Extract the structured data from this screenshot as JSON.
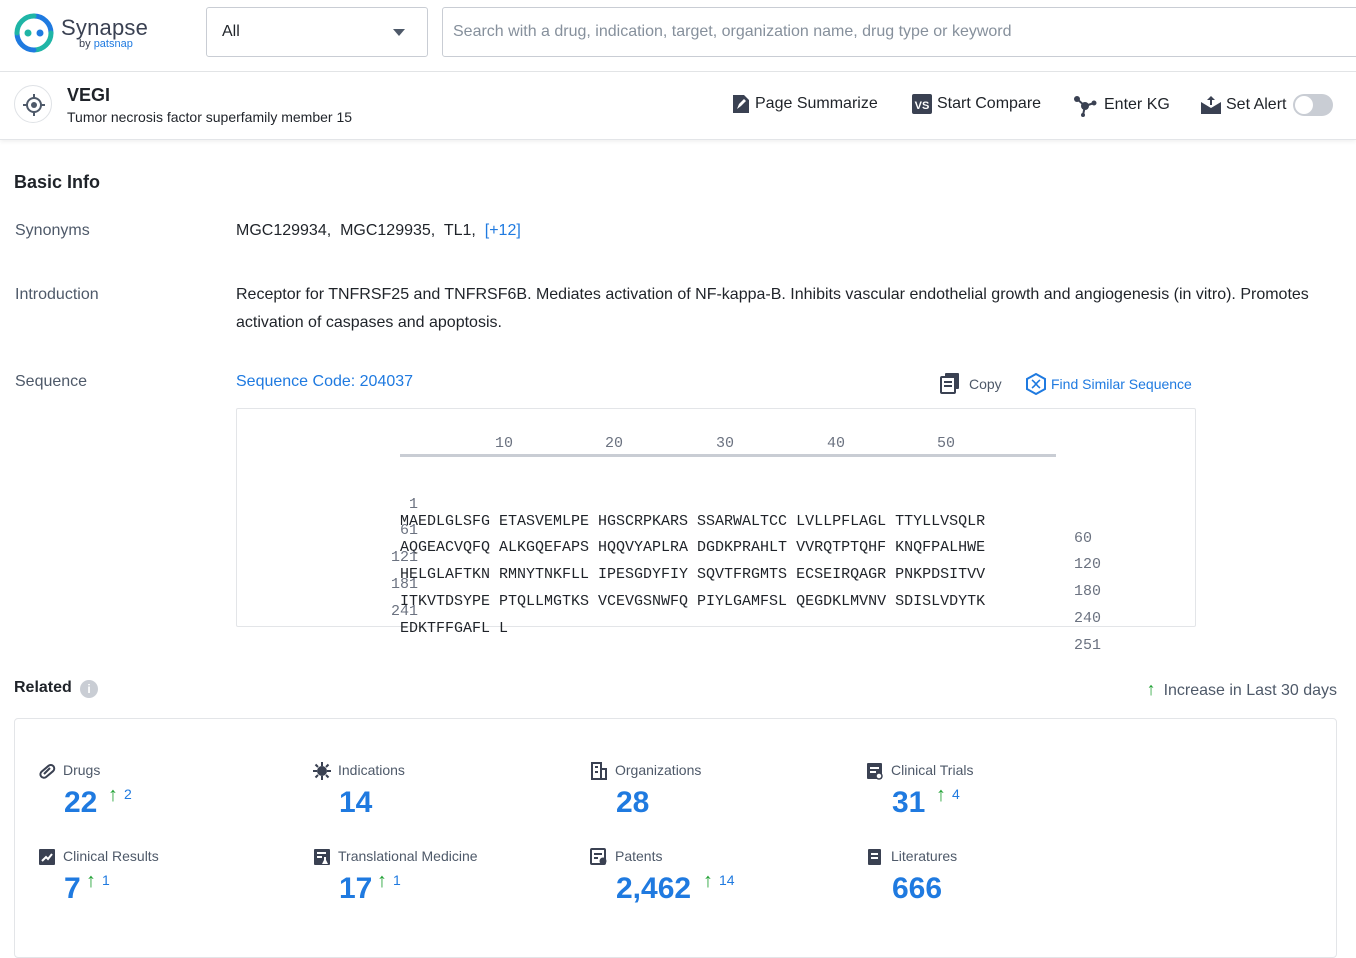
{
  "header": {
    "brand": "Synapse",
    "brand_by": "by",
    "brand_company": "patsnap",
    "scope_select": {
      "value": "All"
    },
    "search": {
      "placeholder": "Search with a drug, indication, target, organization name, drug type or keyword",
      "value": ""
    }
  },
  "entity": {
    "name": "VEGI",
    "full_name": "Tumor necrosis factor superfamily member 15",
    "actions": {
      "page_summarize": "Page Summarize",
      "start_compare": "Start Compare",
      "enter_kg": "Enter KG",
      "set_alert": "Set Alert"
    },
    "alert_enabled": false
  },
  "basic_info": {
    "title": "Basic Info",
    "synonyms_label": "Synonyms",
    "synonyms": [
      "MGC129934,",
      "MGC129935,",
      "TL1,"
    ],
    "synonyms_more": "[+12]",
    "introduction_label": "Introduction",
    "introduction": "Receptor for TNFRSF25 and TNFRSF6B. Mediates activation of NF-kappa-B. Inhibits vascular endothelial growth and angiogenesis (in vitro). Promotes activation of caspases and apoptosis.",
    "sequence_label": "Sequence",
    "sequence_code": "Sequence Code: 204037",
    "copy_label": "Copy",
    "find_similar_label": "Find Similar Sequence",
    "ruler_ticks": [
      "10",
      "20",
      "30",
      "40",
      "50"
    ],
    "sequence_rows": [
      {
        "start": "1",
        "seq": "MAEDLGLSFG ETASVEMLPE HGSCRPKARS SSARWALTCC LVLLPFLAGL TTYLLVSQLR",
        "end": "60"
      },
      {
        "start": "61",
        "seq": "AQGEACVQFQ ALKGQEFAPS HQQVYAPLRA DGDKPRAHLT VVRQTPTQHF KNQFPALHWE",
        "end": "120"
      },
      {
        "start": "121",
        "seq": "HELGLAFTKN RMNYTNKFLL IPESGDYFIY SQVTFRGMTS ECSEIRQAGR PNKPDSITVV",
        "end": "180"
      },
      {
        "start": "181",
        "seq": "ITKVTDSYPE PTQLLMGTKS VCEVGSNWFQ PIYLGAMFSL QEGDKLMVNV SDISLVDYTK",
        "end": "240"
      },
      {
        "start": "241",
        "seq": "EDKTFFGAFL L",
        "end": "251"
      }
    ]
  },
  "related": {
    "title": "Related",
    "increase_legend": "Increase in Last 30 days",
    "stats": [
      {
        "label": "Drugs",
        "value": "22",
        "increase": "2",
        "icon": "pill-icon"
      },
      {
        "label": "Indications",
        "value": "14",
        "increase": "",
        "icon": "virus-icon"
      },
      {
        "label": "Organizations",
        "value": "28",
        "increase": "",
        "icon": "building-icon"
      },
      {
        "label": "Clinical Trials",
        "value": "31",
        "increase": "4",
        "icon": "clipboard-icon"
      },
      {
        "label": "Clinical Results",
        "value": "7",
        "increase": "1",
        "icon": "chart-doc-icon"
      },
      {
        "label": "Translational Medicine",
        "value": "17",
        "increase": "1",
        "icon": "doc-flask-icon"
      },
      {
        "label": "Patents",
        "value": "2,462",
        "increase": "14",
        "icon": "patent-icon"
      },
      {
        "label": "Literatures",
        "value": "666",
        "increase": "",
        "icon": "book-icon"
      }
    ]
  },
  "colors": {
    "accent": "#1f7ae0",
    "increase_arrow": "#23a236",
    "logo_teal": "#1fb5a6",
    "logo_blue": "#1f7ae0"
  }
}
